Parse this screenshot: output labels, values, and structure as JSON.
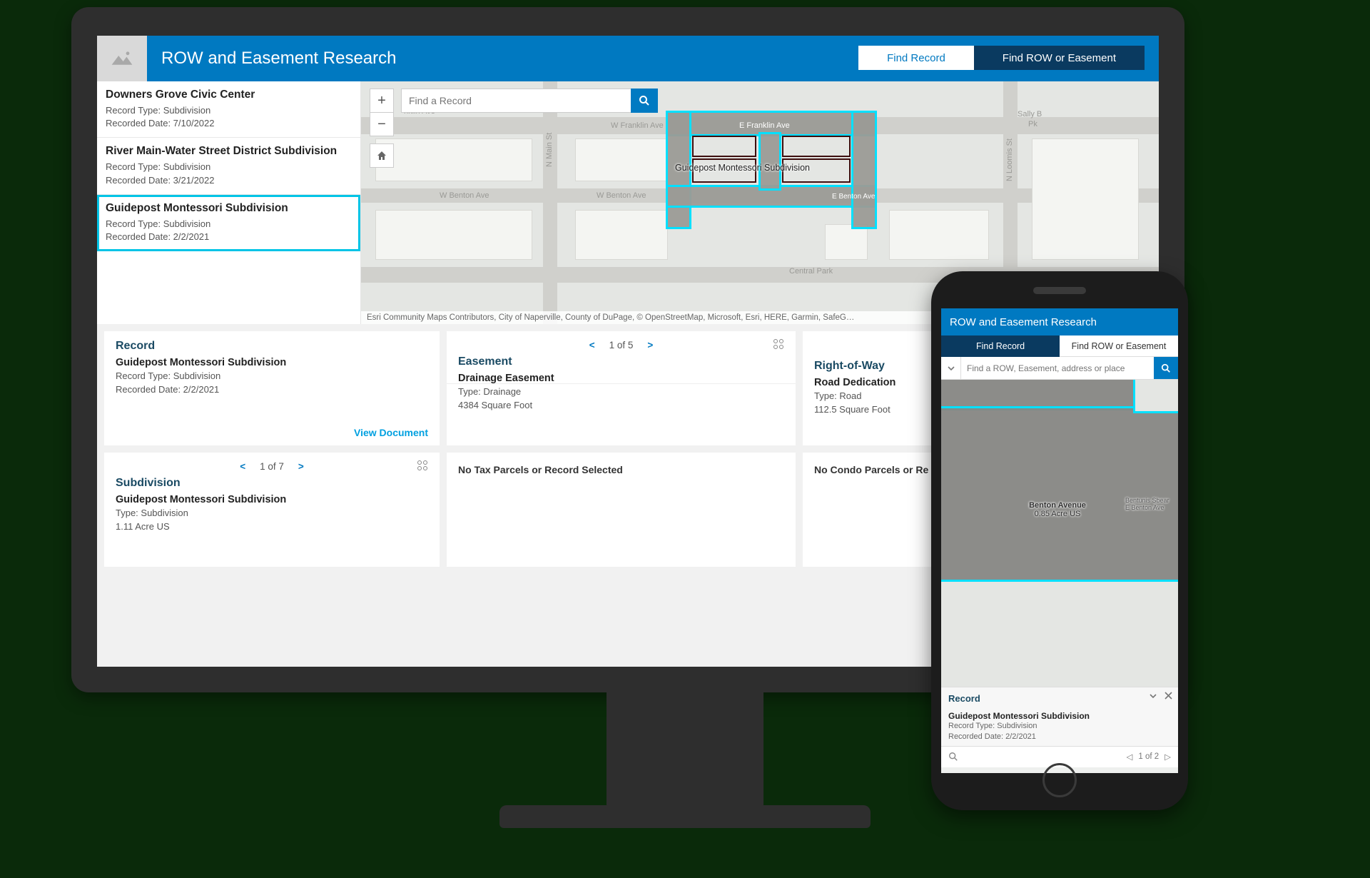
{
  "desktop": {
    "header": {
      "title": "ROW and Easement Research",
      "tabs": {
        "find_record": "Find Record",
        "find_row": "Find ROW or Easement",
        "active": "find_record"
      }
    },
    "record_list": [
      {
        "title": "Downers Grove Civic Center",
        "type_line": "Record Type: Subdivision",
        "date_line": "Recorded Date: 7/10/2022",
        "selected": false
      },
      {
        "title": "River Main-Water Street District Subdivision",
        "type_line": "Record Type: Subdivision",
        "date_line": "Recorded Date: 3/21/2022",
        "selected": false
      },
      {
        "title": "Guidepost Montessori Subdivision",
        "type_line": "Record Type: Subdivision",
        "date_line": "Recorded Date: 2/2/2021",
        "selected": true
      }
    ],
    "map": {
      "search_placeholder": "Find a Record",
      "feature_label": "Guidepost Montessori Subdivision",
      "streets": {
        "w_franklin": "W Franklin Ave",
        "e_franklin": "E Franklin Ave",
        "w_benton": "W Benton Ave",
        "e_benton": "E Benton Ave",
        "n_main": "N Main St",
        "n_loomis": "N Loomis St",
        "nklin": "nklin Ave",
        "central_park": "Central Park",
        "sally": "Sally B",
        "pk": "Pk"
      },
      "attribution": "Esri Community Maps Contributors, City of Naperville, County of DuPage, © OpenStreetMap, Microsoft, Esri, HERE, Garmin, SafeG…"
    },
    "details": {
      "record": {
        "heading": "Record",
        "title": "Guidepost Montessori Subdivision",
        "type_line": "Record Type: Subdivision",
        "date_line": "Recorded Date: 2/2/2021",
        "view_doc": "View Document"
      },
      "subdivision_pager": {
        "text": "1 of 7"
      },
      "subdivision": {
        "heading": "Subdivision",
        "title": "Guidepost Montessori Subdivision",
        "type_line": "Type: Subdivision",
        "area_line": "1.11 Acre US"
      },
      "easement_pager": {
        "text": "1 of 5"
      },
      "easement": {
        "heading": "Easement",
        "title": "Drainage Easement",
        "type_line": "Type: Drainage",
        "area_line": "4384 Square Foot"
      },
      "tax_empty": "No Tax Parcels or Record Selected",
      "row": {
        "heading": "Right-of-Way",
        "title": "Road Dedication",
        "type_line": "Type: Road",
        "area_line": "112.5 Square Foot"
      },
      "condo_empty": "No Condo Parcels or Re"
    }
  },
  "mobile": {
    "title": "ROW and Easement Research",
    "tabs": {
      "find_record": "Find Record",
      "find_row": "Find ROW or Easement",
      "active": "find_record"
    },
    "search_placeholder": "Find a ROW, Easement, address or place",
    "map_label_main": "Benton Avenue",
    "map_label_sub": "0.85 Acre US",
    "map_label_side": "Bentunis Sbear",
    "map_label_side2": "E Benton Ave",
    "record": {
      "heading": "Record",
      "title": "Guidepost Montessori Subdivision",
      "type_line": "Record Type: Subdivision",
      "date_line": "Recorded Date: 2/2/2021"
    },
    "footer_pager": "1 of 2"
  }
}
